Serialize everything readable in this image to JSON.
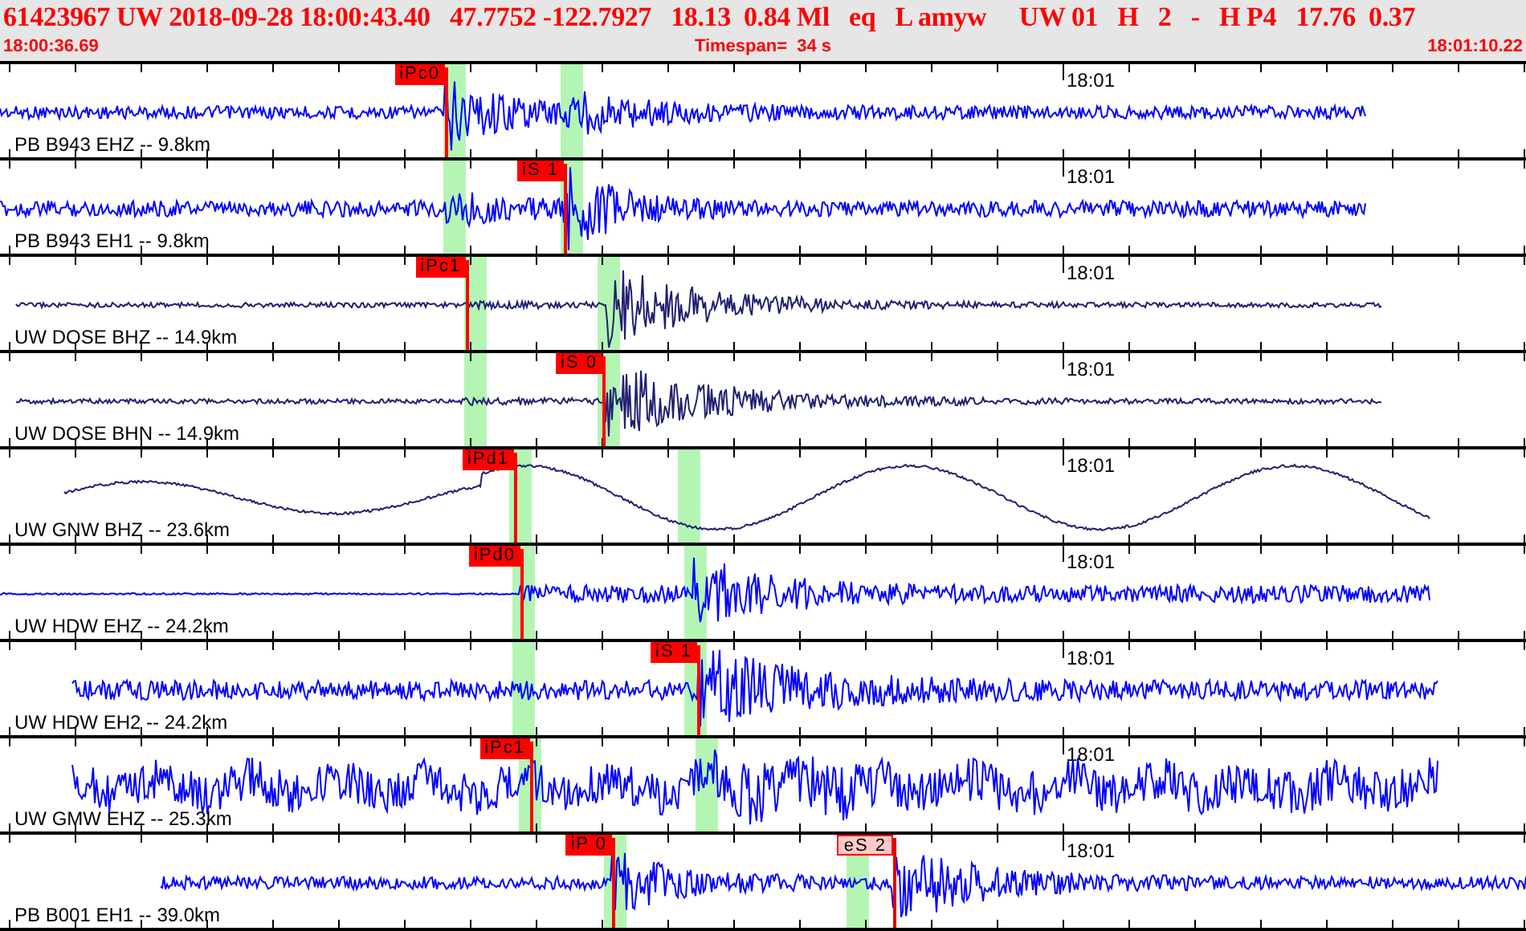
{
  "header": {
    "event_line": "61423967 UW 2018-09-28 18:00:43.40   47.7752 -122.7927   18.13  0.84 Ml   eq   L amyw     UW 01   H   2   -   H P4   17.76  0.37",
    "start_time": "18:00:36.69",
    "timespan": "Timespan=  34 s",
    "end_time": "18:01:10.22"
  },
  "traces": [
    {
      "station": "PB B943 EHZ -- 9.8km",
      "minute_label": "18:01",
      "color": "#0000ff",
      "picks": [
        {
          "label": "iPc0",
          "kind": "manual"
        }
      ]
    },
    {
      "station": "PB B943 EH1 -- 9.8km",
      "minute_label": "18:01",
      "color": "#0000ff",
      "picks": [
        {
          "label": "iS 1",
          "kind": "manual"
        }
      ]
    },
    {
      "station": "UW DOSE BHZ -- 14.9km",
      "minute_label": "18:01",
      "color": "#202070",
      "picks": [
        {
          "label": "iPc1",
          "kind": "manual"
        }
      ]
    },
    {
      "station": "UW DOSE BHN -- 14.9km",
      "minute_label": "18:01",
      "color": "#202070",
      "picks": [
        {
          "label": "iS 0",
          "kind": "manual"
        }
      ]
    },
    {
      "station": "UW GNW BHZ -- 23.6km",
      "minute_label": "18:01",
      "color": "#202070",
      "picks": [
        {
          "label": "iPd1",
          "kind": "manual"
        }
      ]
    },
    {
      "station": "UW HDW EHZ -- 24.2km",
      "minute_label": "18:01",
      "color": "#0000ff",
      "picks": [
        {
          "label": "iPd0",
          "kind": "manual"
        }
      ]
    },
    {
      "station": "UW HDW EH2 -- 24.2km",
      "minute_label": "18:01",
      "color": "#0000ff",
      "picks": [
        {
          "label": "iS 1",
          "kind": "manual"
        }
      ]
    },
    {
      "station": "UW GMW EHZ -- 25.3km",
      "minute_label": "18:01",
      "color": "#0000ff",
      "picks": [
        {
          "label": "iPc1",
          "kind": "manual"
        }
      ]
    },
    {
      "station": "PB B001 EH1 -- 39.0km",
      "minute_label": "18:01",
      "color": "#0000ff",
      "picks": [
        {
          "label": "iP 0",
          "kind": "manual"
        },
        {
          "label": "eS 2",
          "kind": "tentative"
        }
      ]
    }
  ]
}
